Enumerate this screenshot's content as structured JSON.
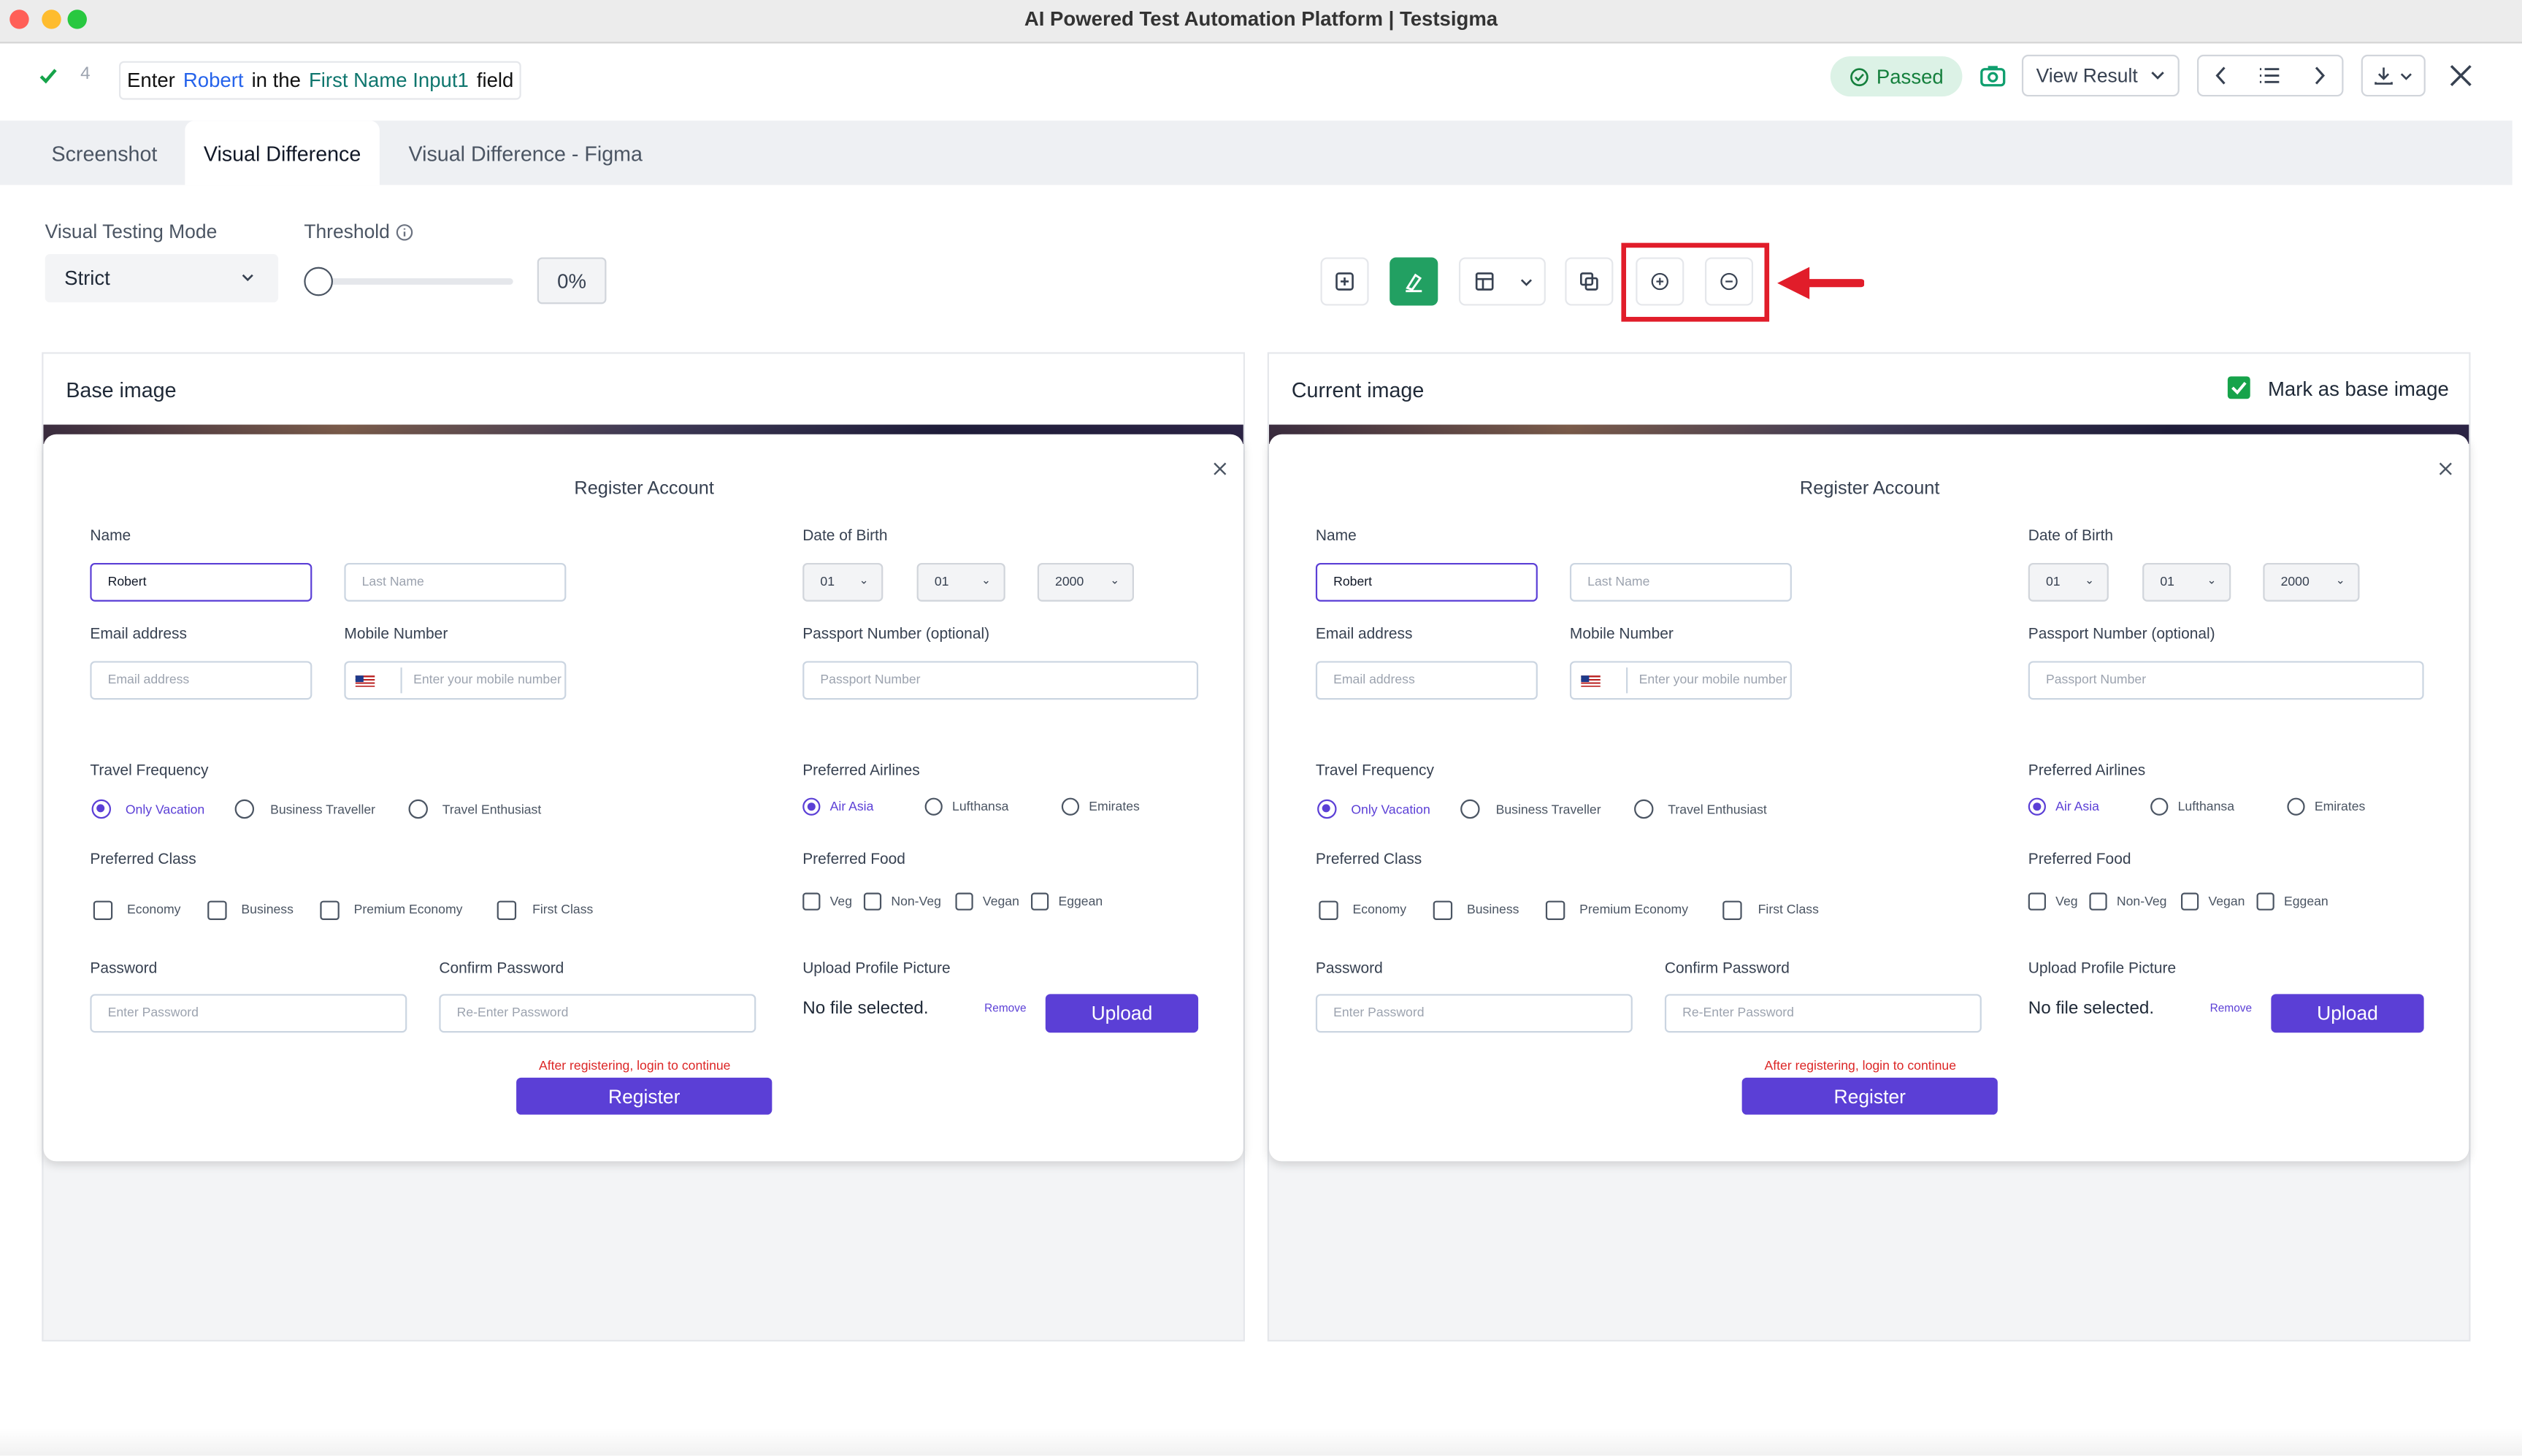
{
  "window": {
    "title": "AI Powered Test Automation Platform | Testsigma"
  },
  "step": {
    "number": "4",
    "parts": [
      "Enter",
      "Robert",
      "in the",
      "First Name Input1",
      "field"
    ],
    "status": "Passed",
    "view_result": "View Result"
  },
  "tabs": [
    "Screenshot",
    "Visual Difference",
    "Visual Difference - Figma"
  ],
  "active_tab": "Visual Difference",
  "controls": {
    "mode_label": "Visual Testing Mode",
    "mode_value": "Strict",
    "threshold_label": "Threshold",
    "threshold_value": "0%",
    "threshold_fraction": 0
  },
  "panels": {
    "base_title": "Base image",
    "current_title": "Current image",
    "mark_base": "Mark as base image"
  },
  "form": {
    "title": "Register Account",
    "name_label": "Name",
    "first_name": "Robert",
    "last_name_ph": "Last Name",
    "dob_label": "Date of Birth",
    "dob_day": "01",
    "dob_month": "01",
    "dob_year": "2000",
    "email_label": "Email address",
    "email_ph": "Email address",
    "mobile_label": "Mobile Number",
    "mobile_ph": "Enter your mobile number",
    "passport_label": "Passport Number (optional)",
    "passport_ph": "Passport Number",
    "travel_label": "Travel Frequency",
    "travel_opts": [
      "Only Vacation",
      "Business Traveller",
      "Travel Enthusiast"
    ],
    "airlines_label": "Preferred Airlines",
    "airline_opts": [
      "Air Asia",
      "Lufthansa",
      "Emirates"
    ],
    "class_label": "Preferred Class",
    "class_opts": [
      "Economy",
      "Business",
      "Premium Economy",
      "First Class"
    ],
    "food_label": "Preferred Food",
    "food_opts": [
      "Veg",
      "Non-Veg",
      "Vegan",
      "Eggean"
    ],
    "password_label": "Password",
    "password_ph": "Enter Password",
    "confirm_label": "Confirm Password",
    "confirm_ph": "Re-Enter Password",
    "upload_label": "Upload Profile Picture",
    "no_file": "No file selected.",
    "remove": "Remove",
    "upload_btn": "Upload",
    "notice": "After registering, login to continue",
    "register_btn": "Register"
  },
  "colors": {
    "accent": "#5b3fd6",
    "green": "#16a34a",
    "highlight": "#e11d2a"
  }
}
